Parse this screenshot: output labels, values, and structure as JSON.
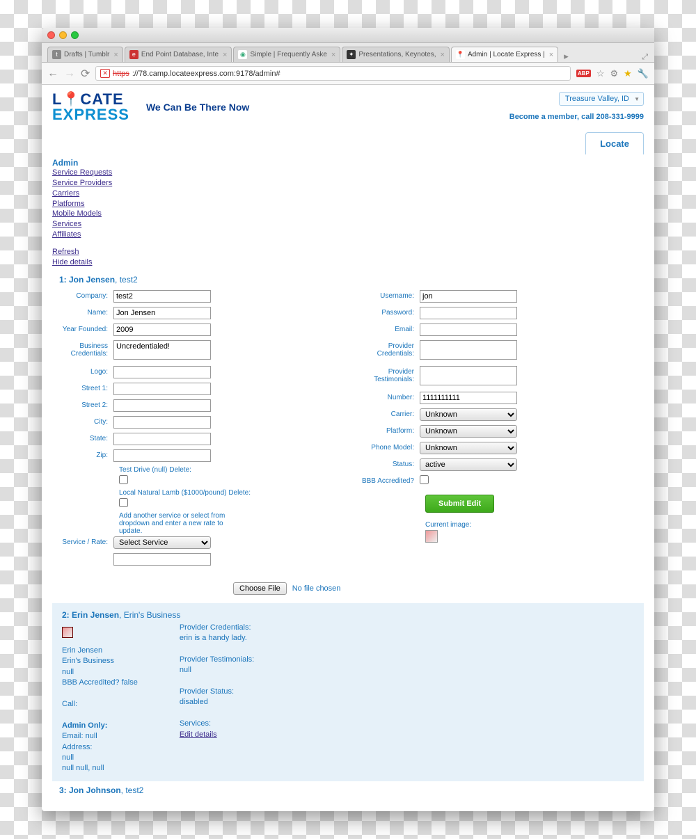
{
  "browser": {
    "tabs": [
      {
        "label": "Drafts | Tumblr"
      },
      {
        "label": "End Point Database, Inte"
      },
      {
        "label": "Simple | Frequently Aske"
      },
      {
        "label": "Presentations, Keynotes,"
      },
      {
        "label": "Admin | Locate Express |",
        "active": true
      }
    ],
    "url_prefix": "https",
    "url": "://78.camp.locateexpress.com:9178/admin#"
  },
  "header": {
    "logo_top": "L",
    "logo_top2": "CATE",
    "logo_bottom": "EXPRESS",
    "tagline": "We Can Be There Now",
    "region": "Treasure Valley, ID",
    "member": "Become a member, call 208-331-9999",
    "locate_tab": "Locate"
  },
  "admin_nav": {
    "heading": "Admin",
    "links": [
      "Service Requests",
      "Service Providers",
      "Carriers",
      "Platforms",
      "Mobile Models",
      "Services",
      "Affiliates"
    ],
    "extra": [
      "Refresh",
      "Hide details"
    ]
  },
  "record1": {
    "title_prefix": "1: Jon Jensen",
    "title_suffix": ", test2",
    "left": {
      "company_label": "Company:",
      "company_value": "test2",
      "name_label": "Name:",
      "name_value": "Jon Jensen",
      "year_label": "Year Founded:",
      "year_value": "2009",
      "cred_label": "Business Credentials:",
      "cred_value": "Uncredentialed!",
      "logo_label": "Logo:",
      "street1_label": "Street 1:",
      "street2_label": "Street 2:",
      "city_label": "City:",
      "state_label": "State:",
      "zip_label": "Zip:",
      "test_drive": "Test Drive (null) Delete:",
      "lamb": "Local Natural Lamb ($1000/pound) Delete:",
      "add_service_note": "Add another service or select from dropdown and enter a new rate to update.",
      "service_rate_label": "Service / Rate:",
      "service_select": "Select Service"
    },
    "right": {
      "username_label": "Username:",
      "username_value": "jon",
      "password_label": "Password:",
      "email_label": "Email:",
      "pcred_label": "Provider Credentials:",
      "ptest_label": "Provider Testimonials:",
      "number_label": "Number:",
      "number_value": "1111111111",
      "carrier_label": "Carrier:",
      "carrier_value": "Unknown",
      "platform_label": "Platform:",
      "platform_value": "Unknown",
      "phone_label": "Phone Model:",
      "phone_value": "Unknown",
      "status_label": "Status:",
      "status_value": "active",
      "bbb_label": "BBB Accredited?",
      "submit": "Submit Edit",
      "current_image": "Current image:"
    },
    "file": {
      "choose": "Choose File",
      "nofile": "No file chosen"
    }
  },
  "record2": {
    "title_prefix": "2: Erin Jensen",
    "title_suffix": ", Erin's Business",
    "left": {
      "l1": "Erin Jensen",
      "l2": "Erin's Business",
      "l3": "null",
      "l4": "BBB Accredited? false",
      "call": "Call:",
      "admin_only": "Admin Only:",
      "a1": "Email: null",
      "a2": "Address:",
      "a3": "null",
      "a4": "null null, null"
    },
    "right": {
      "r1": "Provider Credentials:",
      "r2": "erin is a handy lady.",
      "r3": "Provider Testimonials:",
      "r4": "null",
      "r5": "Provider Status:",
      "r6": "disabled",
      "r7": "Services:",
      "r8": "Edit details"
    }
  },
  "record3": {
    "title_prefix": "3: Jon Johnson",
    "title_suffix": ", test2"
  }
}
